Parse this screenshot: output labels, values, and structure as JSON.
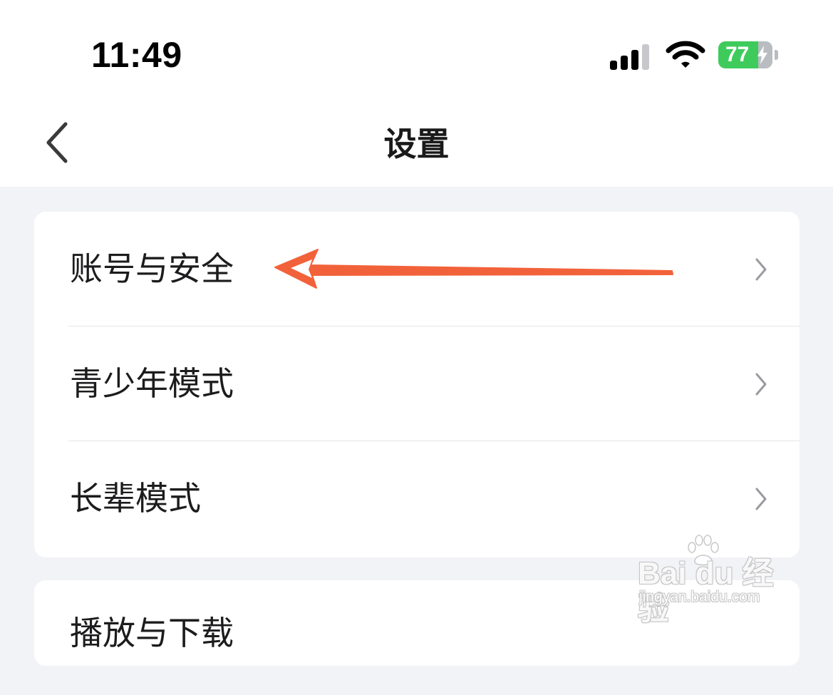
{
  "status_bar": {
    "time": "11:49",
    "battery_level": "77",
    "battery_color": "#3ecb5c",
    "icons": [
      "cellular-signal-icon",
      "wifi-icon",
      "battery-charging-icon"
    ]
  },
  "nav": {
    "title": "设置",
    "back_icon": "chevron-left-icon"
  },
  "settings_groups": [
    {
      "items": [
        {
          "label": "账号与安全",
          "chevron_icon": "chevron-right-icon"
        },
        {
          "label": "青少年模式",
          "chevron_icon": "chevron-right-icon"
        },
        {
          "label": "长辈模式",
          "chevron_icon": "chevron-right-icon"
        }
      ]
    },
    {
      "items": [
        {
          "label": "播放与下载"
        }
      ]
    }
  ],
  "annotation": {
    "type": "hand-drawn-arrow",
    "color": "#f2623a",
    "target": "账号与安全"
  },
  "watermark": {
    "logo_text": "Bai du 经验",
    "url": "jingyan.baidu.com"
  }
}
